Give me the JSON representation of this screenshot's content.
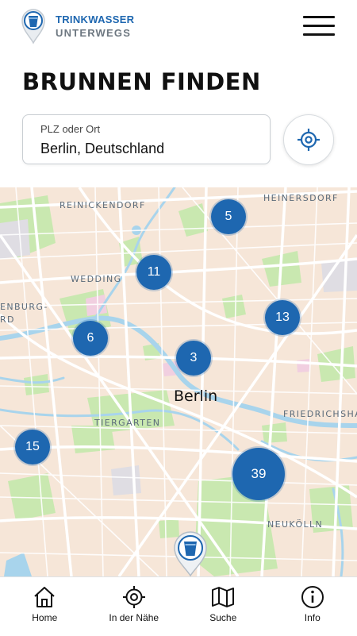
{
  "brand": {
    "line1": "TRINKWASSER",
    "line2": "UNTERWEGS",
    "primary_color": "#1e67b0",
    "secondary_color": "#6d7780"
  },
  "header": {
    "menu_icon": "hamburger-menu-icon"
  },
  "page": {
    "title": "BRUNNEN FINDEN"
  },
  "search": {
    "label": "PLZ oder Ort",
    "value": "Berlin, Deutschland",
    "locate_icon": "crosshair-icon"
  },
  "map": {
    "city": "Berlin",
    "districts": {
      "reinickendorf": "REINICKENDORF",
      "heinersdorf": "HEINERSDORF",
      "wedding": "WEDDING",
      "spandau_partial_1": "ENBURG-",
      "spandau_partial_2": "RD",
      "tiergarten": "TIERGARTEN",
      "friedrichshain": "FRIEDRICHSHA",
      "neukoelln": "NEUKÖLLN"
    },
    "clusters": {
      "c5": "5",
      "c11": "11",
      "c13": "13",
      "c6": "6",
      "c3": "3",
      "c15": "15",
      "c39": "39"
    },
    "colors": {
      "land": "#f6e6d8",
      "park": "#c9e8b0",
      "water": "#a8d4ec",
      "cluster": "#1e67b0"
    }
  },
  "nav": {
    "home": "Home",
    "nearby": "In der Nähe",
    "search": "Suche",
    "info": "Info"
  }
}
